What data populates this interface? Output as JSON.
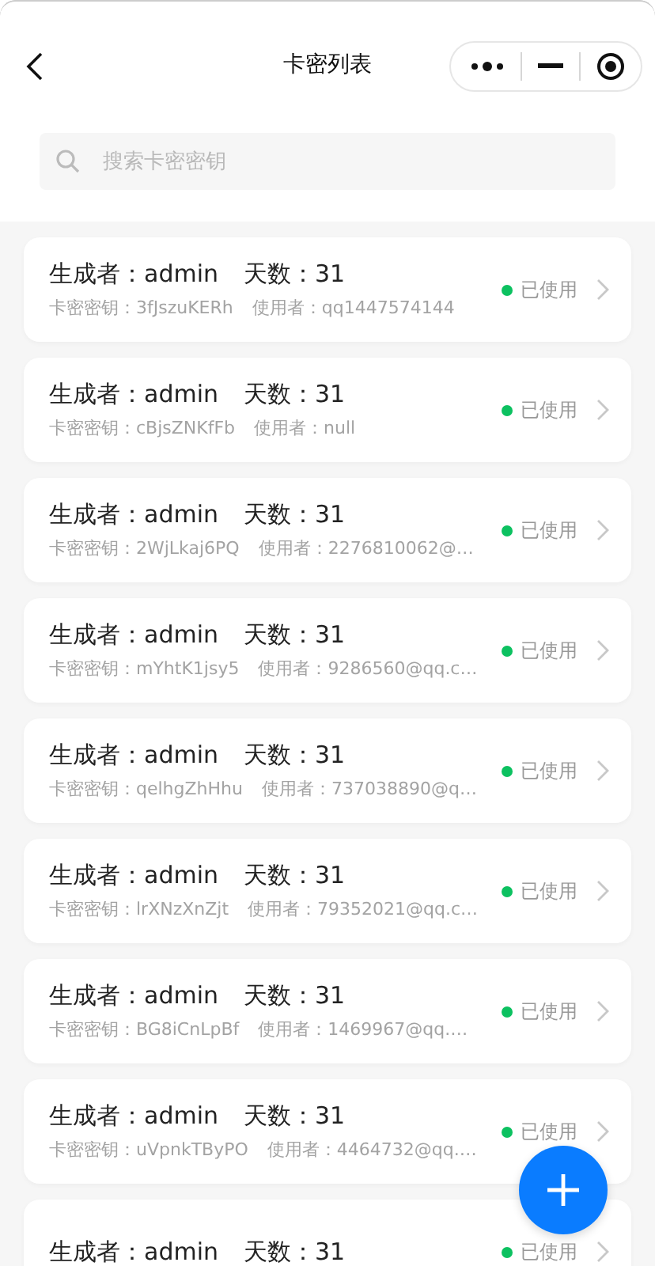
{
  "nav": {
    "title": "卡密列表"
  },
  "search": {
    "placeholder": "搜索卡密密钥"
  },
  "cards": [
    {
      "creator": "生成者：admin",
      "days": "天数：31",
      "key": "卡密密钥：3fJszuKERh",
      "user": "使用者：qq1447574144",
      "status": "已使用",
      "used": true
    },
    {
      "creator": "生成者：admin",
      "days": "天数：31",
      "key": "卡密密钥：cBjsZNKfFb",
      "user": "使用者：null",
      "status": "已使用",
      "used": true
    },
    {
      "creator": "生成者：admin",
      "days": "天数：31",
      "key": "卡密密钥：2WjLkaj6PQ",
      "user": "使用者：2276810062@…",
      "status": "已使用",
      "used": true
    },
    {
      "creator": "生成者：admin",
      "days": "天数：31",
      "key": "卡密密钥：mYhtK1jsy5",
      "user": "使用者：9286560@qq.c…",
      "status": "已使用",
      "used": true
    },
    {
      "creator": "生成者：admin",
      "days": "天数：31",
      "key": "卡密密钥：qelhgZhHhu",
      "user": "使用者：737038890@q…",
      "status": "已使用",
      "used": true
    },
    {
      "creator": "生成者：admin",
      "days": "天数：31",
      "key": "卡密密钥：lrXNzXnZjt",
      "user": "使用者：79352021@qq.c…",
      "status": "已使用",
      "used": true
    },
    {
      "creator": "生成者：admin",
      "days": "天数：31",
      "key": "卡密密钥：BG8iCnLpBf",
      "user": "使用者：1469967@qq.…",
      "status": "已使用",
      "used": true
    },
    {
      "creator": "生成者：admin",
      "days": "天数：31",
      "key": "卡密密钥：uVpnkTByPO",
      "user": "使用者：4464732@qq.…",
      "status": "已使用",
      "used": true
    },
    {
      "creator": "生成者：admin",
      "days": "天数：31",
      "status": "已使用",
      "used": true
    }
  ]
}
